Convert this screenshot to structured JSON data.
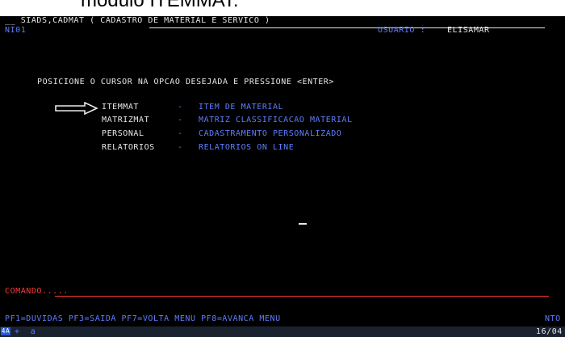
{
  "caption": {
    "text": "módulo ITEMMAT:"
  },
  "header": {
    "system_title": "__ SIADS,CADMAT ( CADASTRO DE MATERIAL E SERVICO )",
    "screen_id": "NI01",
    "user_label": "USUARIO :",
    "user_name": "ELISAMAR"
  },
  "instruction": "POSICIONE O CURSOR NA OPCAO DESEJADA E PRESSIONE <ENTER>",
  "menu": {
    "items": [
      {
        "code": "ITEMMAT",
        "separator": "-",
        "description": "ITEM DE MATERIAL"
      },
      {
        "code": "MATRIZMAT",
        "separator": "-",
        "description": "MATRIZ CLASSIFICACAO MATERIAL"
      },
      {
        "code": "PERSONAL",
        "separator": "-",
        "description": "CADASTRAMENTO PERSONALIZADO"
      },
      {
        "code": "RELATORIOS",
        "separator": "-",
        "description": "RELATORIOS ON LINE"
      }
    ]
  },
  "command": {
    "label": "COMANDO.....",
    "value": ""
  },
  "function_keys": "PF1=DUVIDAS PF3=SAIDA PF7=VOLTA MENU PF8=AVANCA MENU",
  "screen_code": "NTO",
  "status_bar": {
    "badge": "4A",
    "indicator": "+  a",
    "date": "16/04"
  },
  "colors": {
    "background": "#000000",
    "text_white": "#e8e8e8",
    "text_blue": "#5f7dff",
    "command_red": "#ff3a3a"
  },
  "icons": {
    "pointer": "hollow-right-arrow-icon"
  }
}
